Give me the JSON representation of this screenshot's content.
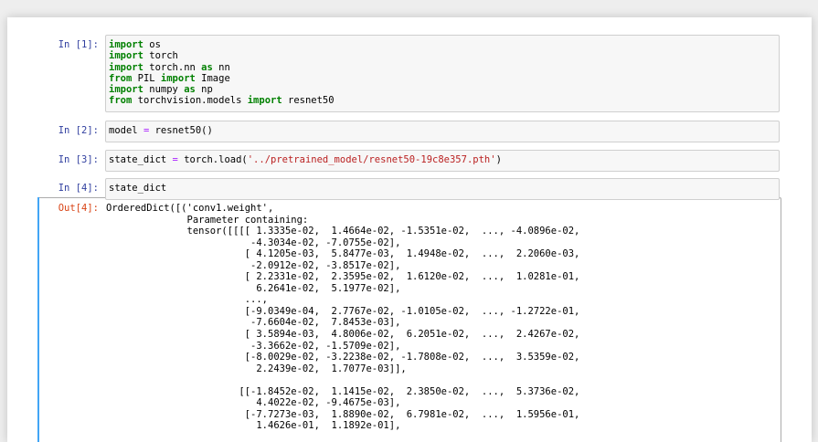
{
  "cells": [
    {
      "prompt": "In [1]:",
      "lines": [
        [
          {
            "t": "import",
            "c": "kw"
          },
          {
            "t": " os"
          }
        ],
        [
          {
            "t": "import",
            "c": "kw"
          },
          {
            "t": " torch"
          }
        ],
        [
          {
            "t": "import",
            "c": "kw"
          },
          {
            "t": " torch.nn "
          },
          {
            "t": "as",
            "c": "kw"
          },
          {
            "t": " nn"
          }
        ],
        [
          {
            "t": "from",
            "c": "kw"
          },
          {
            "t": " PIL "
          },
          {
            "t": "import",
            "c": "kw"
          },
          {
            "t": " Image"
          }
        ],
        [
          {
            "t": "import",
            "c": "kw"
          },
          {
            "t": " numpy "
          },
          {
            "t": "as",
            "c": "kw"
          },
          {
            "t": " np"
          }
        ],
        [
          {
            "t": "from",
            "c": "kw"
          },
          {
            "t": " torchvision.models "
          },
          {
            "t": "import",
            "c": "kw"
          },
          {
            "t": " resnet50"
          }
        ]
      ]
    },
    {
      "prompt": "In [2]:",
      "lines": [
        [
          {
            "t": "model "
          },
          {
            "t": "=",
            "c": "op"
          },
          {
            "t": " resnet50()"
          }
        ]
      ]
    },
    {
      "prompt": "In [3]:",
      "lines": [
        [
          {
            "t": "state_dict "
          },
          {
            "t": "=",
            "c": "op"
          },
          {
            "t": " torch.load("
          },
          {
            "t": "'../pretrained_model/resnet50-19c8e357.pth'",
            "c": "str"
          },
          {
            "t": ")"
          }
        ]
      ]
    },
    {
      "prompt": "In [4]:",
      "lines": [
        [
          {
            "t": "state_dict"
          }
        ]
      ]
    }
  ],
  "output": {
    "prompt": "Out[4]:",
    "lines": [
      "OrderedDict([('conv1.weight',",
      "              Parameter containing:",
      "              tensor([[[[ 1.3335e-02,  1.4664e-02, -1.5351e-02,  ..., -4.0896e-02,",
      "                         -4.3034e-02, -7.0755e-02],",
      "                        [ 4.1205e-03,  5.8477e-03,  1.4948e-02,  ...,  2.2060e-03,",
      "                         -2.0912e-02, -3.8517e-02],",
      "                        [ 2.2331e-02,  2.3595e-02,  1.6120e-02,  ...,  1.0281e-01,",
      "                          6.2641e-02,  5.1977e-02],",
      "                        ...,",
      "                        [-9.0349e-04,  2.7767e-02, -1.0105e-02,  ..., -1.2722e-01,",
      "                         -7.6604e-02,  7.8453e-03],",
      "                        [ 3.5894e-03,  4.8006e-02,  6.2051e-02,  ...,  2.4267e-02,",
      "                         -3.3662e-02, -1.5709e-02],",
      "                        [-8.0029e-02, -3.2238e-02, -1.7808e-02,  ...,  3.5359e-02,",
      "                          2.2439e-02,  1.7077e-03]],",
      "",
      "                       [[-1.8452e-02,  1.1415e-02,  2.3850e-02,  ...,  5.3736e-02,",
      "                          4.4022e-02, -9.4675e-03],",
      "                        [-7.7273e-03,  1.8890e-02,  6.7981e-02,  ...,  1.5956e-01,",
      "                          1.4626e-01,  1.1892e-01],"
    ]
  }
}
